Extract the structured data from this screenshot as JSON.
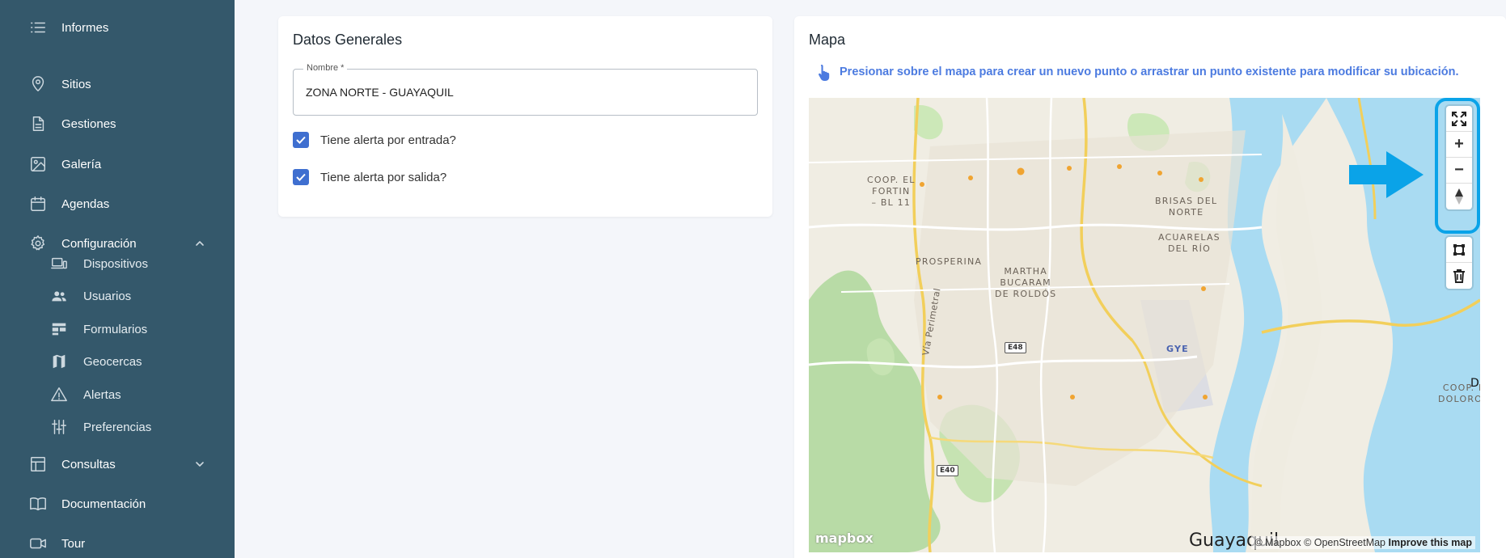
{
  "sidebar": {
    "items": [
      {
        "label": "Informes",
        "icon": "list-icon"
      },
      {
        "label": "Sitios",
        "icon": "location-pin-icon"
      },
      {
        "label": "Gestiones",
        "icon": "document-icon"
      },
      {
        "label": "Galería",
        "icon": "image-icon"
      },
      {
        "label": "Agendas",
        "icon": "calendar-icon"
      },
      {
        "label": "Configuración",
        "icon": "gear-icon",
        "expanded": true
      },
      {
        "label": "Consultas",
        "icon": "table-icon",
        "expanded": false
      },
      {
        "label": "Documentación",
        "icon": "book-icon"
      },
      {
        "label": "Tour",
        "icon": "video-icon"
      }
    ],
    "config_items": [
      {
        "label": "Dispositivos",
        "icon": "devices-icon"
      },
      {
        "label": "Usuarios",
        "icon": "users-icon"
      },
      {
        "label": "Formularios",
        "icon": "forms-icon"
      },
      {
        "label": "Geocercas",
        "icon": "map-icon"
      },
      {
        "label": "Alertas",
        "icon": "warning-icon"
      },
      {
        "label": "Preferencias",
        "icon": "sliders-icon"
      }
    ]
  },
  "general": {
    "title": "Datos Generales",
    "name_label": "Nombre *",
    "name_value": "ZONA NORTE - GUAYAQUIL",
    "alert_entry_label": "Tiene alerta por entrada?",
    "alert_entry_checked": true,
    "alert_exit_label": "Tiene alerta por salida?",
    "alert_exit_checked": true
  },
  "map": {
    "title": "Mapa",
    "hint": "Presionar sobre el mapa para crear un nuevo punto o arrastrar un punto existente para modificar su ubicación.",
    "places": {
      "coop_el_fortin": "COOP. EL\nFORTIN\n– BL 11",
      "brisas": "BRISAS DEL\nNORTE",
      "acuarelas": "ACUARELAS\nDEL RÍO",
      "prosperina": "PROSPERINA",
      "martha": "MARTHA\nBUCARAM\nDE ROLDÓS",
      "coop_dolorosa": "COOP. LA\nDOLOROSA",
      "via_perimetral": "Vía Perimetral",
      "gye": "GYE",
      "city": "Guayaquil",
      "edge_letter": "D"
    },
    "shields": {
      "e48": "E48",
      "e40": "E40"
    },
    "controls": {
      "fullscreen": "fullscreen-icon",
      "zoom_in": "+",
      "zoom_out": "−",
      "compass": "compass-icon",
      "draw_polygon": "polygon-icon",
      "delete": "trash-icon"
    },
    "logo": "mapbox",
    "attribution": "© Mapbox © OpenStreetMap",
    "improve": "Improve this map",
    "accent": "#0aa3e8"
  }
}
